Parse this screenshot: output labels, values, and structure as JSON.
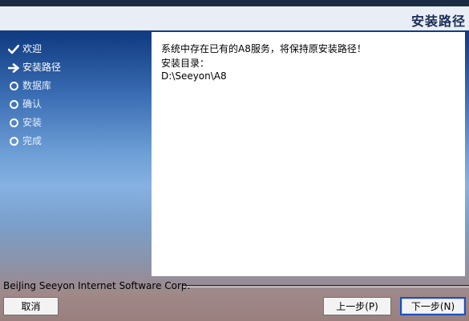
{
  "header": {
    "title": "安装路径"
  },
  "steps": [
    {
      "label": "欢迎",
      "state": "done",
      "icon": "check-icon"
    },
    {
      "label": "安装路径",
      "state": "current",
      "icon": "arrow-right-icon"
    },
    {
      "label": "数据库",
      "state": "pending",
      "icon": "circle-icon"
    },
    {
      "label": "确认",
      "state": "pending",
      "icon": "circle-icon"
    },
    {
      "label": "安装",
      "state": "pending",
      "icon": "circle-icon"
    },
    {
      "label": "完成",
      "state": "pending",
      "icon": "circle-icon"
    }
  ],
  "content": {
    "message": "系统中存在已有的A8服务，将保持原安装路径！",
    "dir_label": "安装目录：",
    "dir_path": "D:\\Seeyon\\A8"
  },
  "footer": {
    "company": "BeiJing Seeyon Internet Software Corp.",
    "cancel_label": "取消",
    "prev_label": "上一步(P)",
    "next_label": "下一步(N)"
  }
}
